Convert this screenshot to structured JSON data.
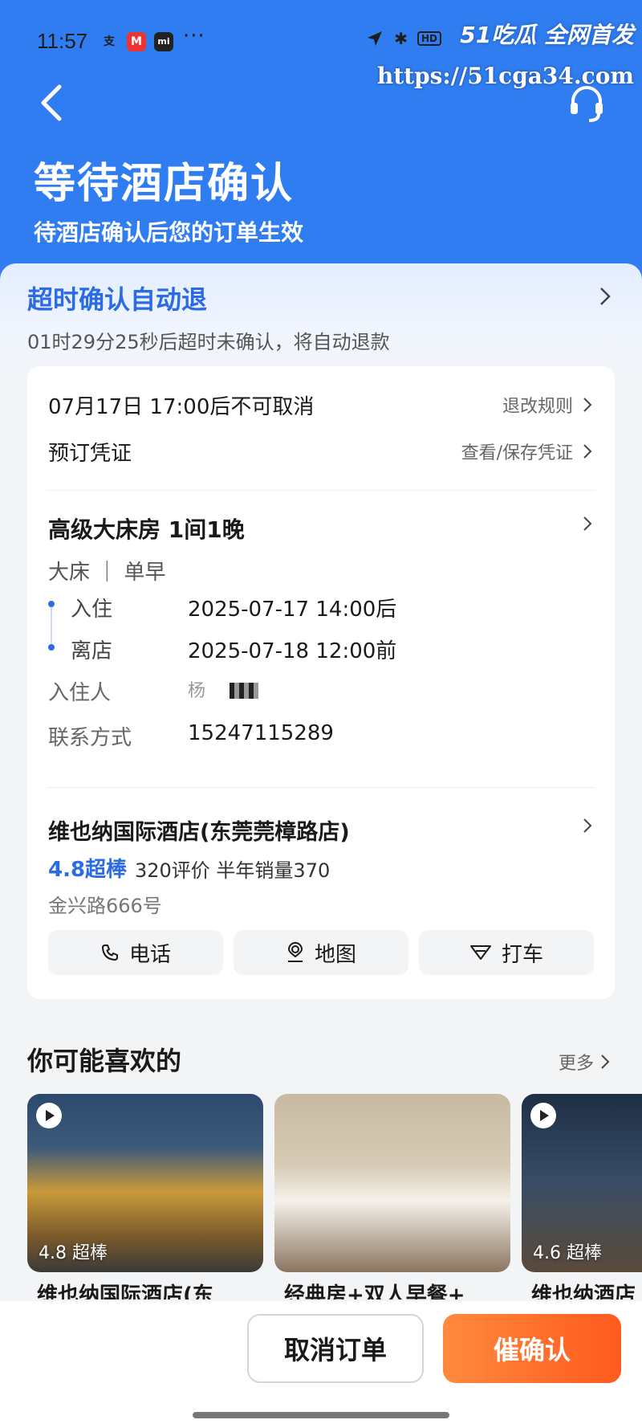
{
  "status_bar": {
    "time": "11:57",
    "icons": [
      "支",
      "M",
      "mi"
    ],
    "more": "···",
    "hd": "HD"
  },
  "watermark": {
    "brand": "51吃瓜 全网首发",
    "url": "https://51cga34.com"
  },
  "header": {
    "title": "等待酒店确认",
    "subtitle": "待酒店确认后您的订单生效"
  },
  "timeout": {
    "title": "超时确认自动退",
    "desc": "01时29分25秒后超时未确认，将自动退款"
  },
  "policy": {
    "cancel_text": "07月17日 17:00后不可取消",
    "cancel_link": "退改规则",
    "voucher_label": "预订凭证",
    "voucher_link": "查看/保存凭证"
  },
  "room": {
    "title": "高级大床房 1间1晚",
    "meta": "大床 ｜ 单早",
    "checkin_label": "入住",
    "checkin_value": "2025-07-17 14:00后",
    "checkout_label": "离店",
    "checkout_value": "2025-07-18 12:00前",
    "guest_label": "入住人",
    "guest_value": "杨",
    "contact_label": "联系方式",
    "contact_value": "15247115289"
  },
  "hotel": {
    "name": "维也纳国际酒店(东莞莞樟路店)",
    "rating": "4.8超棒",
    "reviews": "320评价  半年销量370",
    "address": "金兴路666号"
  },
  "actions": {
    "phone": "电话",
    "map": "地图",
    "taxi": "打车"
  },
  "recommend": {
    "title": "你可能喜欢的",
    "more": "更多",
    "items": [
      {
        "rating": "4.8 超棒",
        "name": "维也纳国际酒店(东"
      },
      {
        "rating": "",
        "name": "经典房+双人早餐+"
      },
      {
        "rating": "4.6 超棒",
        "name": "维也纳酒店"
      }
    ]
  },
  "bottom": {
    "cancel": "取消订单",
    "urge": "催确认"
  }
}
